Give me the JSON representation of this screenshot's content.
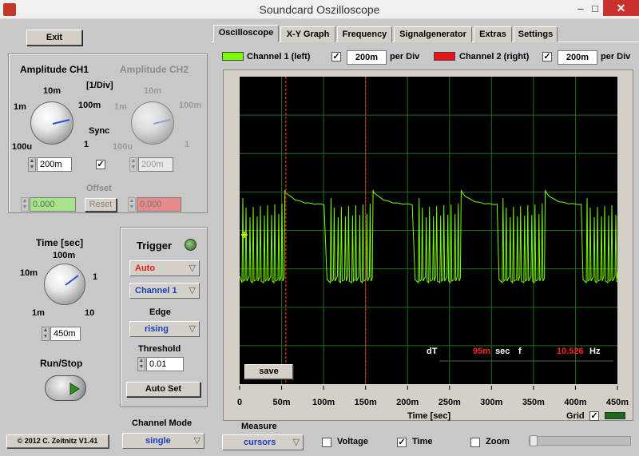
{
  "window": {
    "title": "Soundcard Oszilloscope",
    "minimize": "–",
    "maximize": "□",
    "close": "✕"
  },
  "left": {
    "exit": "Exit",
    "amp_ch1": "Amplitude CH1",
    "amp_ch2": "Amplitude CH2",
    "div_unit": "[1/Div]",
    "amp_ticks": {
      "t10m": "10m",
      "t100m": "100m",
      "t1m": "1m",
      "t1": "1",
      "t100u": "100u"
    },
    "ch1_value": "200m",
    "ch2_value": "200m",
    "sync": "Sync",
    "sync_checked": true,
    "offset": "Offset",
    "offset_ch1": "0.000",
    "offset_ch2": "0.000",
    "reset": "Reset",
    "time_label": "Time [sec]",
    "time_ticks": {
      "t100m": "100m",
      "t10m": "10m",
      "t1": "1",
      "t1m": "1m",
      "t10": "10"
    },
    "time_value": "450m",
    "run_stop": "Run/Stop",
    "trigger": "Trigger",
    "trigger_mode": "Auto",
    "trigger_channel": "Channel 1",
    "edge_label": "Edge",
    "edge_value": "rising",
    "threshold_label": "Threshold",
    "threshold_value": "0.01",
    "auto_set": "Auto Set",
    "channel_mode_label": "Channel Mode",
    "channel_mode_value": "single",
    "copyright": "© 2012  C. Zeitnitz V1.41"
  },
  "tabs": [
    "Oscilloscope",
    "X-Y Graph",
    "Frequency",
    "Signalgenerator",
    "Extras",
    "Settings"
  ],
  "channels": {
    "ch1_label": "Channel 1 (left)",
    "ch1_color": "#7cfc00",
    "ch1_div": "200m",
    "ch2_label": "Channel 2 (right)",
    "ch2_color": "#e8141a",
    "ch2_div": "200m",
    "per_div": "per Div"
  },
  "scope": {
    "dT_label": "dT",
    "dT_value": "95m",
    "sec": "sec",
    "f_label": "f",
    "f_value": "10.526",
    "hz": "Hz",
    "save": "save",
    "x_label": "Time [sec]",
    "grid_label": "Grid",
    "grid_checked": true
  },
  "chart_data": {
    "type": "line",
    "xlabel": "Time [sec]",
    "x_ticks": [
      "0",
      "50m",
      "100m",
      "150m",
      "200m",
      "250m",
      "300m",
      "350m",
      "400m",
      "450m"
    ],
    "xlim": [
      0,
      0.45
    ],
    "grid": true,
    "cursors_x": [
      0.055,
      0.15
    ],
    "burst_starts": [
      0.0,
      0.105,
      0.21,
      0.31,
      0.41
    ],
    "burst_end_offset": 0.053,
    "series": [
      {
        "values_desc": null
      }
    ]
  },
  "measure": {
    "label": "Measure",
    "mode": "cursors",
    "voltage": "Voltage",
    "voltage_checked": false,
    "time": "Time",
    "time_checked": true,
    "zoom": "Zoom",
    "zoom_checked": false
  }
}
